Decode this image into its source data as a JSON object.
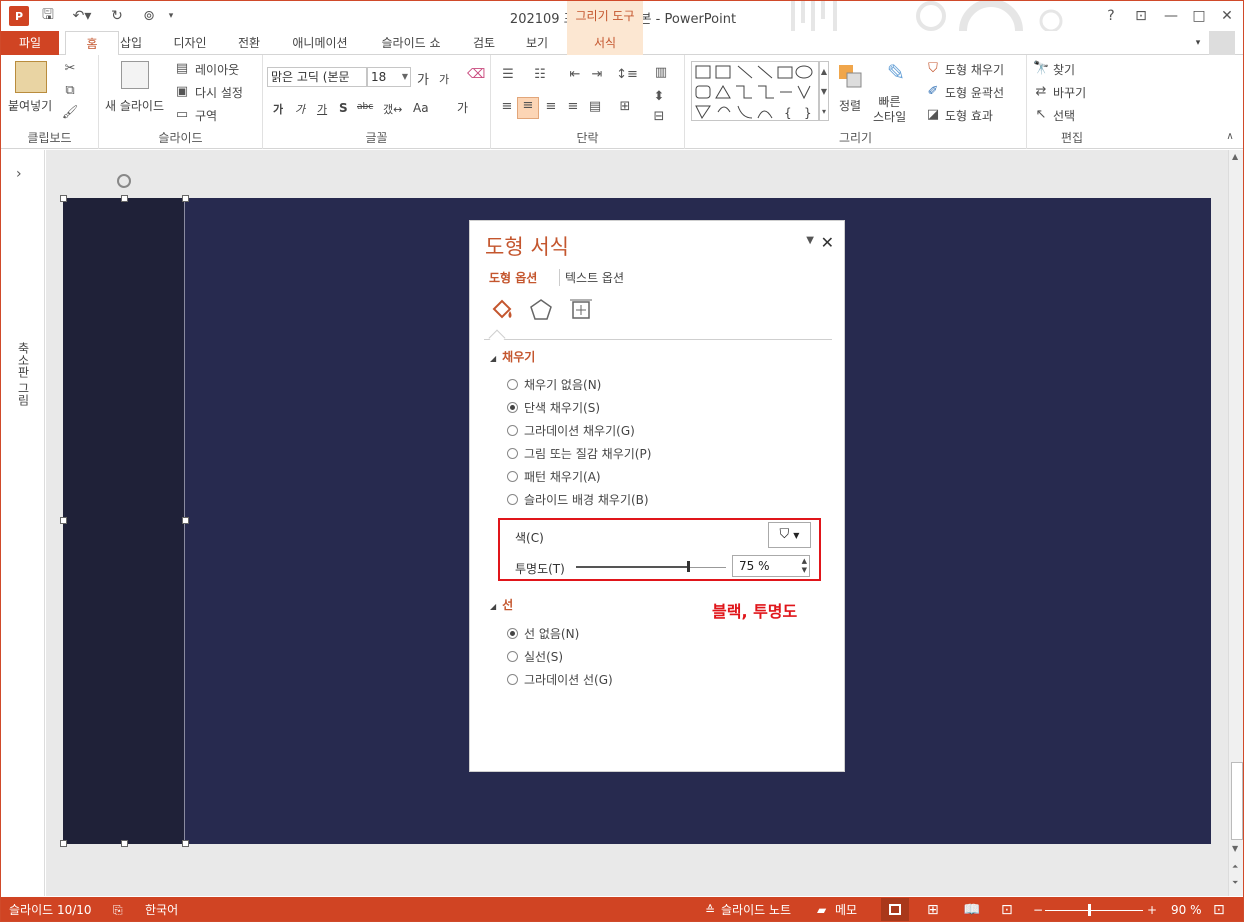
{
  "window": {
    "title": "202109 포스팅용 완성본 - PowerPoint",
    "app_icon": "P",
    "context_tools": "그리기 도구",
    "buttons": {
      "help": "?",
      "ribbon_display": "⊡",
      "minimize": "—",
      "maximize": "□",
      "close": "✕"
    }
  },
  "tabs": {
    "file": "파일",
    "home": "홈",
    "insert": "삽입",
    "design": "디자인",
    "transitions": "전환",
    "animations": "애니메이션",
    "slideshow": "슬라이드 쇼",
    "review": "검토",
    "view": "보기",
    "format": "서식"
  },
  "ribbon": {
    "clipboard": {
      "label": "클립보드",
      "paste": "붙여넣기"
    },
    "slides": {
      "label": "슬라이드",
      "new_slide": "새 슬라이드",
      "layout": "레이아웃",
      "reset": "다시 설정",
      "section": "구역"
    },
    "font": {
      "label": "글꼴",
      "font_name": "맑은 고딕 (본문",
      "font_size": "18",
      "grow": "가",
      "shrink": "가",
      "bold": "가",
      "italic": "가",
      "underline": "가",
      "shadow": "S",
      "strike": "abc",
      "spacing": "갰↔",
      "case": "Aa",
      "color": "가"
    },
    "paragraph": {
      "label": "단락"
    },
    "drawing": {
      "label": "그리기",
      "arrange": "정렬",
      "quick_styles": "빠른\n스타일",
      "shape_fill": "도형 채우기",
      "shape_outline": "도형 윤곽선",
      "shape_effects": "도형 효과"
    },
    "editing": {
      "label": "편집",
      "find": "찾기",
      "replace": "바꾸기",
      "select": "선택"
    }
  },
  "thumbnail_bar": {
    "label": "축소판 그림",
    "expand": "›"
  },
  "format_pane": {
    "title": "도형 서식",
    "tabs": {
      "shape_options": "도형 옵션",
      "text_options": "텍스트 옵션"
    },
    "fill_section": {
      "title": "채우기",
      "options": [
        {
          "label": "채우기 없음(N)",
          "selected": false
        },
        {
          "label": "단색 채우기(S)",
          "selected": true
        },
        {
          "label": "그라데이션 채우기(G)",
          "selected": false
        },
        {
          "label": "그림 또는 질감 채우기(P)",
          "selected": false
        },
        {
          "label": "패턴 채우기(A)",
          "selected": false
        },
        {
          "label": "슬라이드 배경 채우기(B)",
          "selected": false
        }
      ],
      "color_label": "색(C)",
      "transparency_label": "투명도(T)",
      "transparency_value": "75 %",
      "transparency_fraction": 0.75
    },
    "line_section": {
      "title": "선",
      "options": [
        {
          "label": "선 없음(N)",
          "selected": true
        },
        {
          "label": "실선(S)",
          "selected": false
        },
        {
          "label": "그라데이션 선(G)",
          "selected": false
        }
      ]
    },
    "annotation": "블랙, 투명도"
  },
  "status_bar": {
    "slide_info": "슬라이드 10/10",
    "language": "한국어",
    "notes": "슬라이드 노트",
    "comments": "메모",
    "zoom": "90 %"
  },
  "colors": {
    "accent": "#d04423",
    "slide_bg": "#272a4f",
    "shape_fill": "#1f2138",
    "annotation": "#e0151a"
  }
}
